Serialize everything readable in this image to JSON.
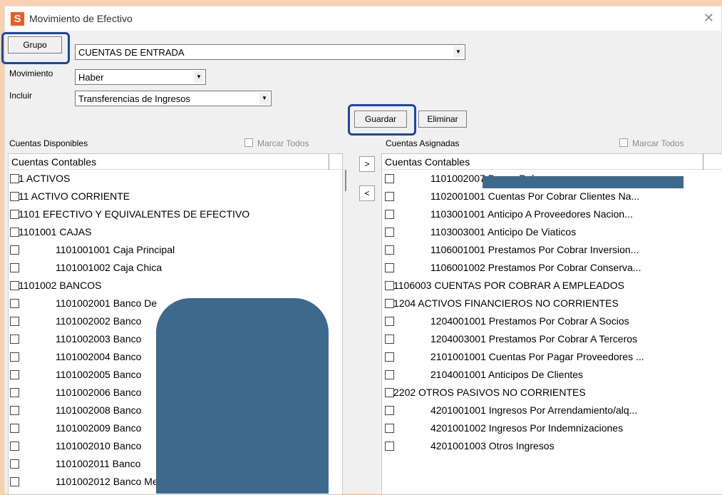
{
  "window": {
    "title": "Movimiento de Efectivo",
    "app_icon": "S",
    "close_glyph": "✕"
  },
  "form": {
    "grupo_button": "Grupo",
    "grupo_value": "CUENTAS DE ENTRADA",
    "movimiento_label": "Movimiento",
    "movimiento_value": "Haber",
    "incluir_label": "Incluir",
    "incluir_value": "Transferencias de Ingresos",
    "guardar_button": "Guardar",
    "eliminar_button": "Eliminar"
  },
  "left_panel": {
    "title": "Cuentas Disponibles",
    "marcar_todos": "Marcar Todos",
    "column_header": "Cuentas Contables",
    "rows": [
      {
        "text": "1 ACTIVOS",
        "level": 0
      },
      {
        "text": "11 ACTIVO CORRIENTE",
        "level": 0
      },
      {
        "text": "1101 EFECTIVO Y EQUIVALENTES DE EFECTIVO",
        "level": 0
      },
      {
        "text": "1101001 CAJAS",
        "level": 0
      },
      {
        "text": "1101001001 Caja Principal",
        "level": 1
      },
      {
        "text": "1101001002 Caja Chica",
        "level": 1
      },
      {
        "text": "1101002 BANCOS",
        "level": 0
      },
      {
        "text": "1101002001 Banco De",
        "level": 1
      },
      {
        "text": "1101002002 Banco",
        "level": 1
      },
      {
        "text": "1101002003 Banco",
        "level": 1
      },
      {
        "text": "1101002004 Banco",
        "level": 1
      },
      {
        "text": "1101002005 Banco",
        "level": 1
      },
      {
        "text": "1101002006 Banco",
        "level": 1
      },
      {
        "text": "1101002008 Banco",
        "level": 1
      },
      {
        "text": "1101002009 Banco",
        "level": 1
      },
      {
        "text": "1101002010 Banco",
        "level": 1
      },
      {
        "text": "1101002011 Banco",
        "level": 1
      },
      {
        "text": "1101002012 Banco Me",
        "level": 1
      }
    ]
  },
  "transfer": {
    "add": ">",
    "remove": "<"
  },
  "right_panel": {
    "title": "Cuentas Asignadas",
    "marcar_todos": "Marcar Todos",
    "column_header": "Cuentas Contables",
    "rows": [
      {
        "text": "1101002007 Banco Del",
        "level": 1
      },
      {
        "text": "1102001001 Cuentas Por Cobrar Clientes Na...",
        "level": 1
      },
      {
        "text": "1103001001 Anticipo A Proveedores Nacion...",
        "level": 1
      },
      {
        "text": "1103003001 Anticipo De Viaticos",
        "level": 1
      },
      {
        "text": "1106001001 Prestamos Por Cobrar  Inversion...",
        "level": 1
      },
      {
        "text": "1106001002 Prestamos Por Cobrar  Conserva...",
        "level": 1
      },
      {
        "text": "1106003 CUENTAS POR COBRAR A EMPLEADOS",
        "level": 0
      },
      {
        "text": "1204 ACTIVOS FINANCIEROS NO CORRIENTES",
        "level": 0
      },
      {
        "text": "1204001001 Prestamos Por Cobrar A Socios",
        "level": 1
      },
      {
        "text": "1204003001 Prestamos Por Cobrar A Terceros",
        "level": 1
      },
      {
        "text": "2101001001 Cuentas Por Pagar Proveedores ...",
        "level": 1
      },
      {
        "text": "2104001001 Anticipos De Clientes",
        "level": 1
      },
      {
        "text": "2202 OTROS PASIVOS NO CORRIENTES",
        "level": 0
      },
      {
        "text": "4201001001 Ingresos Por Arrendamiento/alq...",
        "level": 1
      },
      {
        "text": "4201001002 Ingresos Por Indemnizaciones",
        "level": 1
      },
      {
        "text": "4201001003 Otros Ingresos",
        "level": 1
      }
    ]
  },
  "colors": {
    "background": "#f6d2b0",
    "highlight": "#1c46a7",
    "redaction": "#3d698c",
    "app_icon": "#ec5b24"
  }
}
